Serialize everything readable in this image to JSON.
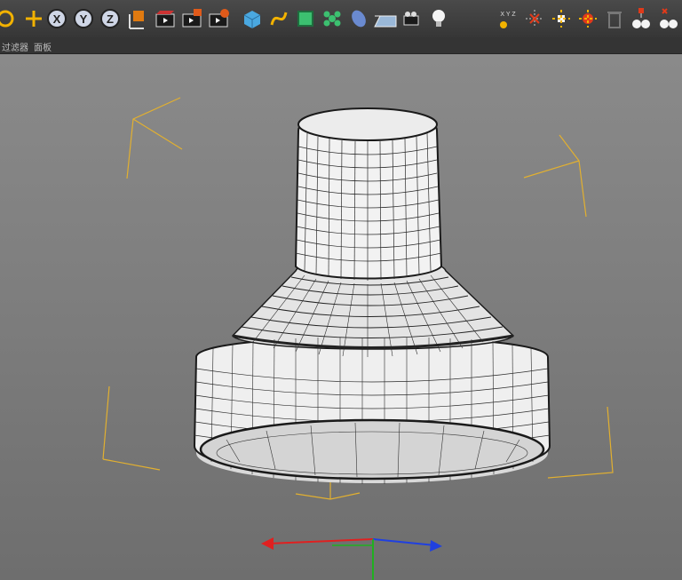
{
  "toolbar": {
    "groups": [
      {
        "name": "transform",
        "buttons": [
          "rotate-icon",
          "move-icon"
        ]
      },
      {
        "name": "axis-lock",
        "buttons": [
          "x-axis-lock",
          "y-axis-lock",
          "z-axis-lock",
          "world-coordinate-toggle"
        ]
      },
      {
        "name": "render",
        "buttons": [
          "render-view-icon",
          "render-picture-viewer-icon",
          "render-settings-icon"
        ]
      },
      {
        "name": "create",
        "buttons": [
          "cube-icon",
          "spline-pen-icon",
          "subdivision-icon",
          "cloner-icon",
          "deformer-icon",
          "floor-icon",
          "camera-icon",
          "light-icon"
        ]
      },
      {
        "name": "tools",
        "buttons": [
          "axis-tool-icon",
          "snap-icon",
          "workplane-icon",
          "parent-icon",
          "delete-icon",
          "material-icon",
          "tag-icon"
        ]
      }
    ],
    "axis_labels": {
      "x": "X",
      "y": "Y",
      "z": "Z"
    }
  },
  "menubar": {
    "items": [
      "过滤器",
      "面板"
    ]
  },
  "viewport": {
    "axis_colors": {
      "x": "#e02020",
      "y": "#20b020",
      "z": "#2040e0"
    }
  }
}
